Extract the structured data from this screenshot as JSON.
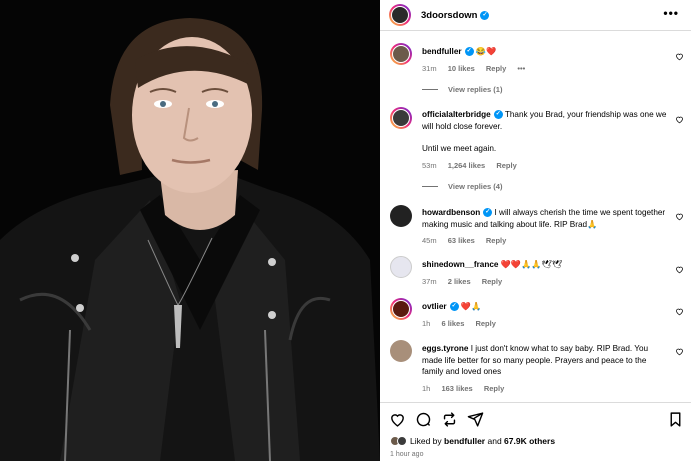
{
  "post": {
    "author": "3doorsdown",
    "more_icon": "more-horizontal-icon",
    "photo_alt": "Portrait of a man with long hair wearing a black leather jacket"
  },
  "comments": [
    {
      "user": "bendfuller",
      "verified": true,
      "text": " 😂❤️",
      "time": "31m",
      "likes": "10 likes",
      "reply": "Reply",
      "extra": "•••",
      "view_replies": "View replies (1)"
    },
    {
      "user": "officialalterbridge",
      "verified": true,
      "text": " Thank you Brad, your friendship was one we will hold close forever.",
      "text2": "Until we meet again.",
      "time": "53m",
      "likes": "1,264 likes",
      "reply": "Reply",
      "view_replies": "View replies (4)"
    },
    {
      "user": "howardbenson",
      "verified": true,
      "text": " I will always cherish the time we spent together making music and talking about life. RIP Brad🙏",
      "time": "45m",
      "likes": "63 likes",
      "reply": "Reply"
    },
    {
      "user": "shinedown__france",
      "verified": false,
      "text": " ❤️❤️🙏🙏🕊🕊",
      "time": "37m",
      "likes": "2 likes",
      "reply": "Reply"
    },
    {
      "user": "ovtlier",
      "verified": true,
      "text": " ❤️🙏",
      "time": "1h",
      "likes": "6 likes",
      "reply": "Reply"
    },
    {
      "user": "eggs.tyrone",
      "verified": false,
      "text": " I just don't know what to say baby. RIP Brad. You made life better for so many people. Prayers and peace to the family and loved ones",
      "time": "1h",
      "likes": "163 likes",
      "reply": "Reply"
    }
  ],
  "footer": {
    "liked_by_prefix": "Liked by ",
    "liked_by_user": "bendfuller",
    "and": " and ",
    "others": "67.9K others",
    "time_ago": "1 hour ago"
  },
  "colors": {
    "verified": "#0095f6",
    "meta": "#737373",
    "divider": "#dbdbdb"
  }
}
